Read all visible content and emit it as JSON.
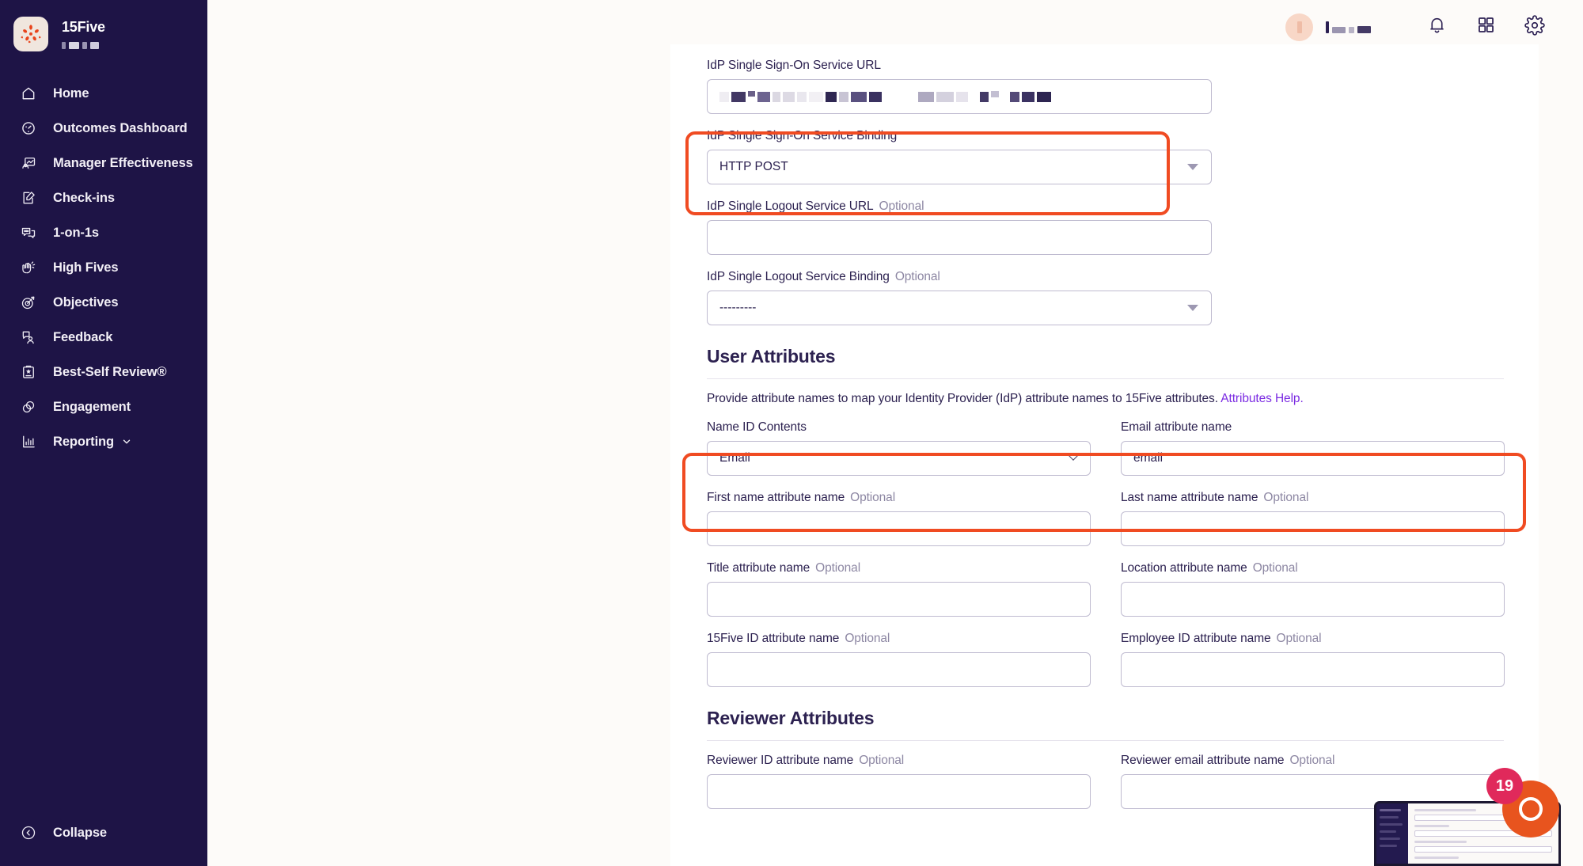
{
  "brand": {
    "name": "15Five",
    "logo_icon": "15five-logo-icon",
    "subtitle_redacted": true
  },
  "sidebar": {
    "items": [
      {
        "label": "Home",
        "icon": "home-icon",
        "key": "home"
      },
      {
        "label": "Outcomes Dashboard",
        "icon": "gauge-icon",
        "key": "outcomes-dashboard"
      },
      {
        "label": "Manager Effectiveness",
        "icon": "manager-chart-icon",
        "key": "manager-effectiveness"
      },
      {
        "label": "Check-ins",
        "icon": "note-edit-icon",
        "key": "check-ins"
      },
      {
        "label": "1-on-1s",
        "icon": "chat-bubbles-icon",
        "key": "1-on-1s"
      },
      {
        "label": "High Fives",
        "icon": "hand-wave-icon",
        "key": "high-fives"
      },
      {
        "label": "Objectives",
        "icon": "target-arrow-icon",
        "key": "objectives"
      },
      {
        "label": "Feedback",
        "icon": "feedback-person-icon",
        "key": "feedback"
      },
      {
        "label": "Best-Self Review®",
        "icon": "award-clipboard-icon",
        "key": "best-self-review"
      },
      {
        "label": "Engagement",
        "icon": "overlapping-circles-icon",
        "key": "engagement"
      },
      {
        "label": "Reporting",
        "icon": "bar-chart-icon",
        "key": "reporting",
        "caret": "chevron-down-icon"
      }
    ],
    "collapse": {
      "label": "Collapse",
      "icon": "chevron-left-circle-icon"
    }
  },
  "topbar": {
    "user_name_redacted": true,
    "notifications_icon": "bell-icon",
    "apps_icon": "grid-apps-icon",
    "settings_icon": "gear-icon"
  },
  "form": {
    "idp_sso_url": {
      "label": "IdP Single Sign-On Service URL",
      "value_redacted": true,
      "value": ""
    },
    "idp_sso_binding": {
      "label": "IdP Single Sign-On Service Binding",
      "value": "HTTP POST",
      "highlighted": true
    },
    "idp_slo_url": {
      "label": "IdP Single Logout Service URL",
      "optional": "Optional",
      "value": ""
    },
    "idp_slo_binding": {
      "label": "IdP Single Logout Service Binding",
      "optional": "Optional",
      "value": "---------"
    },
    "user_attributes": {
      "title": "User Attributes",
      "help_text": "Provide attribute names to map your Identity Provider (IdP) attribute names to 15Five attributes.",
      "help_link": "Attributes Help.",
      "fields": [
        {
          "label": "Name ID Contents",
          "optional": "",
          "value": "Email",
          "type": "select",
          "highlighted": true
        },
        {
          "label": "Email attribute name",
          "optional": "",
          "value": "email",
          "type": "text",
          "highlighted": true
        },
        {
          "label": "First name attribute name",
          "optional": "Optional",
          "value": "",
          "type": "text"
        },
        {
          "label": "Last name attribute name",
          "optional": "Optional",
          "value": "",
          "type": "text"
        },
        {
          "label": "Title attribute name",
          "optional": "Optional",
          "value": "",
          "type": "text"
        },
        {
          "label": "Location attribute name",
          "optional": "Optional",
          "value": "",
          "type": "text"
        },
        {
          "label": "15Five ID attribute name",
          "optional": "Optional",
          "value": "",
          "type": "text"
        },
        {
          "label": "Employee ID attribute name",
          "optional": "Optional",
          "value": "",
          "type": "text"
        }
      ]
    },
    "reviewer_attributes": {
      "title": "Reviewer Attributes",
      "fields": [
        {
          "label": "Reviewer ID attribute name",
          "optional": "Optional",
          "value": "",
          "type": "text"
        },
        {
          "label": "Reviewer email attribute name",
          "optional": "Optional",
          "value": "",
          "type": "text"
        }
      ]
    }
  },
  "support_widget": {
    "badge_count": "19",
    "launcher_icon": "support-chat-icon"
  },
  "colors": {
    "sidebar_bg": "#1E1446",
    "page_bg": "#FDFBF9",
    "card_bg": "#FFFFFF",
    "annotation_red": "#F04B22",
    "link_purple": "#7B2BE2",
    "text_primary": "#2C2150",
    "text_muted": "#8D87A3",
    "border": "#BFBBD0",
    "badge_red": "#E0295B",
    "launcher_orange": "#E8541E"
  }
}
